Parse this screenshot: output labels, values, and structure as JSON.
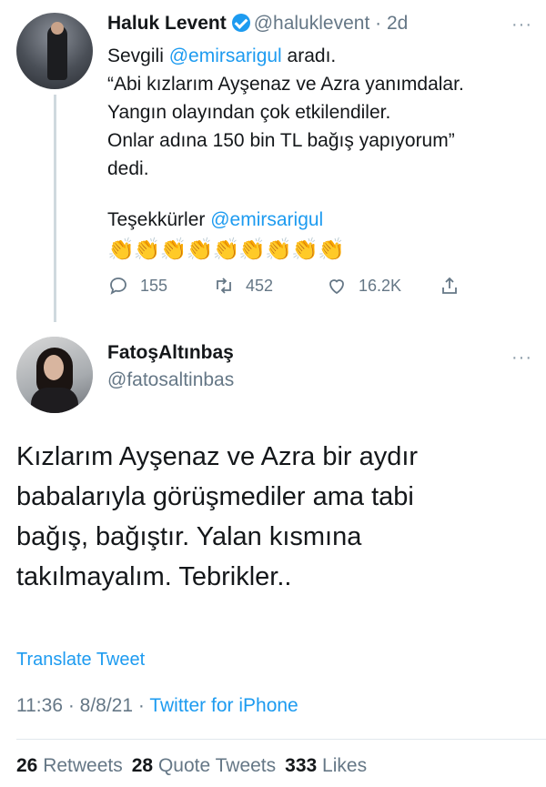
{
  "reply_tweet": {
    "name": "Haluk Levent",
    "handle": "@haluklevent",
    "age": "· 2d",
    "lines": [
      {
        "pre": "Sevgili ",
        "mention": "@emirsarigul",
        "post": " aradı."
      },
      {
        "text": "“Abi kızlarım Ayşenaz ve Azra yanımdalar."
      },
      {
        "text": "Yangın olayından çok etkilendiler."
      },
      {
        "text": "Onlar adına 150 bin TL bağış yapıyorum”"
      },
      {
        "text": "dedi."
      }
    ],
    "thanks": "Teşekkürler ",
    "thanks_mention": "@emirsarigul",
    "emoji": "👏👏👏👏👏👏👏👏👏",
    "replies": "155",
    "retweets": "452",
    "likes": "16.2K",
    "icons": [
      "reply-icon",
      "retweet-icon",
      "like-icon",
      "share-icon"
    ]
  },
  "main_tweet": {
    "name": "FatoşAltınbaş",
    "handle": "@fatosaltinbas",
    "body_lines": [
      "Kızlarım Ayşenaz ve Azra bir aydır",
      "babalarıyla görüşmediler ama tabi",
      "bağış, bağıştır. Yalan kısmına",
      "takılmayalım. Tebrikler.."
    ],
    "translate": "Translate Tweet",
    "time": "11:36 · 8/8/21 · ",
    "source": "Twitter for iPhone",
    "stats": {
      "retweets_count": "26",
      "retweets_label": "Retweets",
      "quotes_count": "28",
      "quotes_label": "Quote Tweets",
      "likes_count": "333",
      "likes_label": "Likes"
    }
  },
  "colors": {
    "accent": "#1d9bf0",
    "secondary_text": "#657786",
    "primary_text": "#14171a"
  }
}
